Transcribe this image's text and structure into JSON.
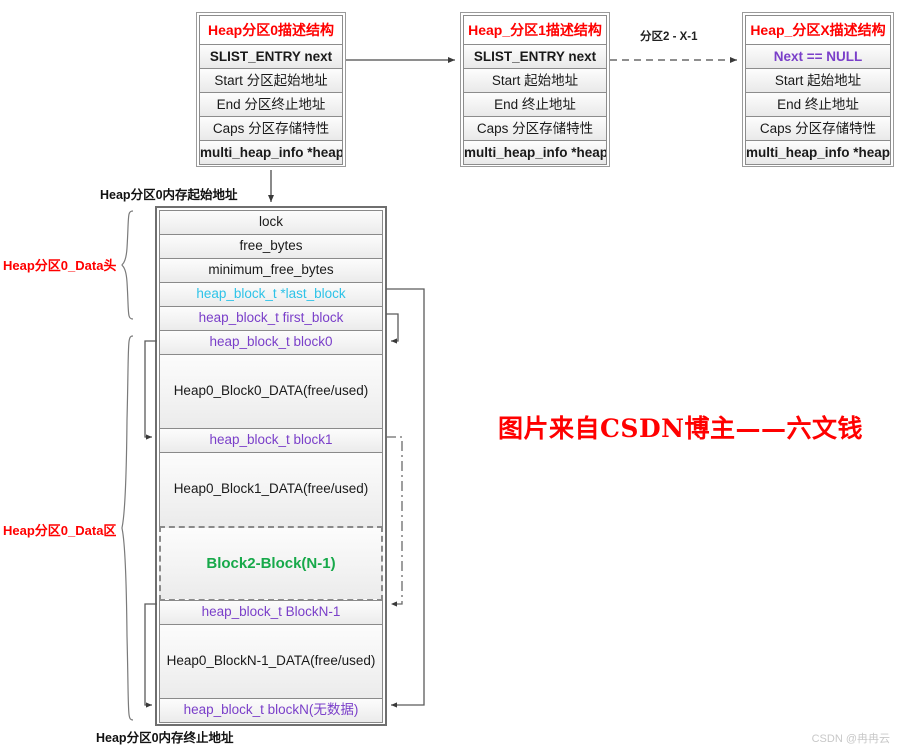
{
  "diagram": {
    "title_banner": "图片来自CSDN博主——六文钱",
    "watermark": "CSDN @冉冉云",
    "link_arrow_label": "分区2 - X-1"
  },
  "partition_structs": [
    {
      "id": "partition0",
      "title": "Heap分区0描述结构",
      "rows": [
        {
          "text": "SLIST_ENTRY next",
          "style": "bold"
        },
        {
          "text": "Start  分区起始地址",
          "style": "normal"
        },
        {
          "text": "End   分区终止地址",
          "style": "normal"
        },
        {
          "text": "Caps 分区存储特性",
          "style": "normal"
        },
        {
          "text": "multi_heap_info *heap",
          "style": "bold"
        }
      ]
    },
    {
      "id": "partition1",
      "title": "Heap_分区1描述结构",
      "rows": [
        {
          "text": "SLIST_ENTRY next",
          "style": "bold"
        },
        {
          "text": "Start 起始地址",
          "style": "normal"
        },
        {
          "text": "End 终止地址",
          "style": "normal"
        },
        {
          "text": "Caps 分区存储特性",
          "style": "normal"
        },
        {
          "text": "multi_heap_info *heap",
          "style": "bold"
        }
      ]
    },
    {
      "id": "partitionX",
      "title": "Heap_分区X描述结构",
      "rows": [
        {
          "text": "Next == NULL",
          "style": "purple-bold"
        },
        {
          "text": "Start 起始地址",
          "style": "normal"
        },
        {
          "text": "End 终止地址",
          "style": "normal"
        },
        {
          "text": "Caps 分区存储特性",
          "style": "normal"
        },
        {
          "text": "multi_heap_info *heap",
          "style": "bold"
        }
      ]
    }
  ],
  "heap_column": {
    "start_address_label": "Heap分区0内存起始地址",
    "end_address_label": "Heap分区0内存终止地址",
    "bracket_head_label": "Heap分区0_Data头",
    "bracket_data_label": "Heap分区0_Data区",
    "rows": [
      {
        "text": "lock",
        "kind": "hdr"
      },
      {
        "text": "free_bytes",
        "kind": "hdr"
      },
      {
        "text": "minimum_free_bytes",
        "kind": "hdr"
      },
      {
        "text": "heap_block_t *last_block",
        "kind": "meta-cyan"
      },
      {
        "text": "heap_block_t  first_block",
        "kind": "meta-purple"
      },
      {
        "text": "heap_block_t  block0",
        "kind": "meta-purple"
      },
      {
        "text": "Heap0_Block0_DATA(free/used)",
        "kind": "data"
      },
      {
        "text": "heap_block_t  block1",
        "kind": "meta-purple"
      },
      {
        "text": "Heap0_Block1_DATA(free/used)",
        "kind": "data"
      },
      {
        "text": "Block2-Block(N-1)",
        "kind": "ellipsis"
      },
      {
        "text": "heap_block_t BlockN-1",
        "kind": "meta-purple"
      },
      {
        "text": "Heap0_BlockN-1_DATA(free/used)",
        "kind": "data"
      },
      {
        "text": "heap_block_t  blockN(无数据)",
        "kind": "meta-purple"
      }
    ]
  },
  "colors": {
    "title_red": "#ff0000",
    "pointer_purple": "#7a3fc9",
    "last_block_cyan": "#2ec3e8",
    "ellipsis_green": "#17a94a",
    "border_gray": "#8a8a8a",
    "watermark_gray": "#c8c8c8"
  }
}
